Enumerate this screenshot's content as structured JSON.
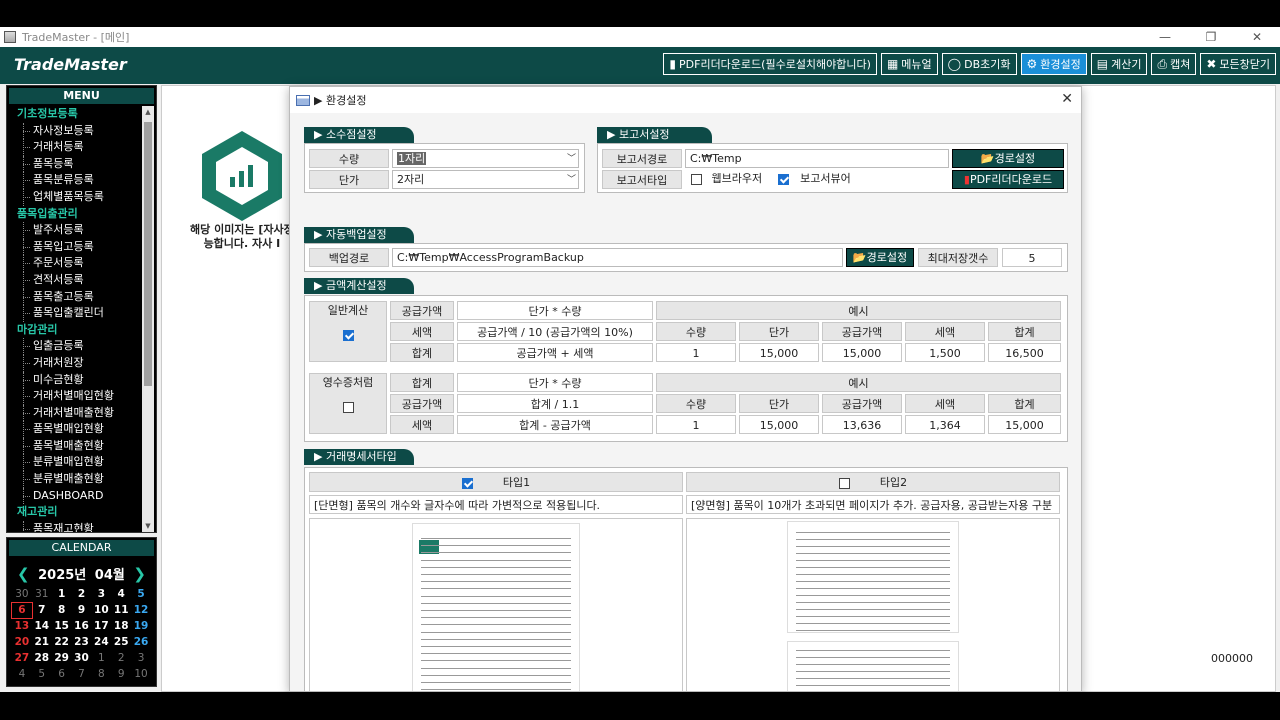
{
  "window": {
    "title": "TradeMaster - [메인]",
    "controls": [
      "—",
      "❐",
      "✕"
    ]
  },
  "brand": "TradeMaster",
  "top_buttons": [
    {
      "label": "PDF리더다운로드(필수로설치해야합니다)",
      "icon": "pdf-icon"
    },
    {
      "label": "메뉴얼",
      "icon": "manual-icon"
    },
    {
      "label": "DB초기화",
      "icon": "reset-icon"
    },
    {
      "label": "환경설정",
      "icon": "gear-icon",
      "active": true
    },
    {
      "label": "계산기",
      "icon": "calculator-icon"
    },
    {
      "label": "캡쳐",
      "icon": "capture-icon"
    },
    {
      "label": "모든창닫기",
      "icon": "close-all-icon"
    }
  ],
  "sidebar": {
    "title": "MENU",
    "items": [
      {
        "label": "기초정보등록",
        "type": "cat"
      },
      {
        "label": "자사정보등록",
        "type": "sub"
      },
      {
        "label": "거래처등록",
        "type": "sub"
      },
      {
        "label": "품목등록",
        "type": "sub"
      },
      {
        "label": "품목분류등록",
        "type": "sub"
      },
      {
        "label": "업체별품목등록",
        "type": "sub"
      },
      {
        "label": "품목입출관리",
        "type": "cat"
      },
      {
        "label": "발주서등록",
        "type": "sub"
      },
      {
        "label": "품목입고등록",
        "type": "sub"
      },
      {
        "label": "주문서등록",
        "type": "sub"
      },
      {
        "label": "견적서등록",
        "type": "sub"
      },
      {
        "label": "품목출고등록",
        "type": "sub"
      },
      {
        "label": "품목입출캘린더",
        "type": "sub"
      },
      {
        "label": "마감관리",
        "type": "cat"
      },
      {
        "label": "입출금등록",
        "type": "sub"
      },
      {
        "label": "거래처원장",
        "type": "sub"
      },
      {
        "label": "미수금현황",
        "type": "sub"
      },
      {
        "label": "거래처별매입현황",
        "type": "sub"
      },
      {
        "label": "거래처별매출현황",
        "type": "sub"
      },
      {
        "label": "품목별매입현황",
        "type": "sub"
      },
      {
        "label": "품목별매출현황",
        "type": "sub"
      },
      {
        "label": "분류별매입현황",
        "type": "sub"
      },
      {
        "label": "분류별매출현황",
        "type": "sub"
      },
      {
        "label": "DASHBOARD",
        "type": "sub"
      },
      {
        "label": "재고관리",
        "type": "cat"
      },
      {
        "label": "품목재고현황",
        "type": "sub"
      }
    ]
  },
  "calendar": {
    "title": "CALENDAR",
    "year_label": "2025년",
    "month_label": "04월",
    "days": [
      [
        "30",
        "dim"
      ],
      [
        "31",
        "dim"
      ],
      [
        "1",
        ""
      ],
      [
        "2",
        ""
      ],
      [
        "3",
        ""
      ],
      [
        "4",
        ""
      ],
      [
        "5",
        "sat"
      ],
      [
        "6",
        "sun today"
      ],
      [
        "7",
        ""
      ],
      [
        "8",
        ""
      ],
      [
        "9",
        ""
      ],
      [
        "10",
        ""
      ],
      [
        "11",
        ""
      ],
      [
        "12",
        "sat"
      ],
      [
        "13",
        "sun"
      ],
      [
        "14",
        ""
      ],
      [
        "15",
        ""
      ],
      [
        "16",
        ""
      ],
      [
        "17",
        ""
      ],
      [
        "18",
        ""
      ],
      [
        "19",
        "sat"
      ],
      [
        "20",
        "sun"
      ],
      [
        "21",
        ""
      ],
      [
        "22",
        ""
      ],
      [
        "23",
        ""
      ],
      [
        "24",
        ""
      ],
      [
        "25",
        ""
      ],
      [
        "26",
        "sat"
      ],
      [
        "27",
        "sun"
      ],
      [
        "28",
        ""
      ],
      [
        "29",
        ""
      ],
      [
        "30",
        ""
      ],
      [
        "1",
        "dim"
      ],
      [
        "2",
        "dim"
      ],
      [
        "3",
        "dim"
      ],
      [
        "4",
        "dim"
      ],
      [
        "5",
        "dim"
      ],
      [
        "6",
        "dim"
      ],
      [
        "7",
        "dim"
      ],
      [
        "8",
        "dim"
      ],
      [
        "9",
        "dim"
      ],
      [
        "10",
        "dim"
      ]
    ]
  },
  "main": {
    "logo_text_line1": "해당 이미지는 [자사정",
    "logo_text_line2": "능합니다. 자사 I",
    "code": "000000",
    "brand_color": "#1a7a66"
  },
  "dialog": {
    "title": "▶ 환경설정",
    "close": "✕",
    "decimal": {
      "header": "▶ 소수점설정",
      "qty_label": "수량",
      "qty_value": "1자리",
      "price_label": "단가",
      "price_value": "2자리"
    },
    "report": {
      "header": "▶ 보고서설정",
      "path_label": "보고서경로",
      "path_value": "C:₩Temp",
      "path_button": "경로설정",
      "type_label": "보고서타입",
      "web_label": "웹브라우저",
      "viewer_label": "보고서뷰어",
      "pdf_button": "PDF리더다운로드"
    },
    "backup": {
      "header": "▶ 자동백업설정",
      "path_label": "백업경로",
      "path_value": "C:₩Temp₩AccessProgramBackup",
      "path_button": "경로설정",
      "max_label": "최대저장갯수",
      "max_value": "5"
    },
    "amount": {
      "header": "▶ 금액계산설정",
      "general_label": "일반계산",
      "general_rows": [
        [
          "공급가액",
          "단가 * 수량"
        ],
        [
          "세액",
          "공급가액 / 10 (공급가액의 10%)"
        ],
        [
          "합계",
          "공급가액 + 세액"
        ]
      ],
      "example_label": "예시",
      "example_headers": [
        "수량",
        "단가",
        "공급가액",
        "세액",
        "합계"
      ],
      "general_example": [
        "1",
        "15,000",
        "15,000",
        "1,500",
        "16,500"
      ],
      "receipt_label": "영수증처럼",
      "receipt_rows": [
        [
          "합계",
          "단가 * 수량"
        ],
        [
          "공급가액",
          "합계 / 1.1"
        ],
        [
          "세액",
          "합계 - 공급가액"
        ]
      ],
      "receipt_example": [
        "1",
        "15,000",
        "13,636",
        "1,364",
        "15,000"
      ]
    },
    "statement": {
      "header": "▶ 거래명세서타입",
      "type1": "타입1",
      "type2": "타입2",
      "desc1": "[단면형] 품목의 개수와 글자수에 따라 가변적으로 적용됩니다.",
      "desc2": "[양면형] 품목이 10개가 초과되면 페이지가 추가. 공급자용, 공급받는자용 구분"
    }
  }
}
